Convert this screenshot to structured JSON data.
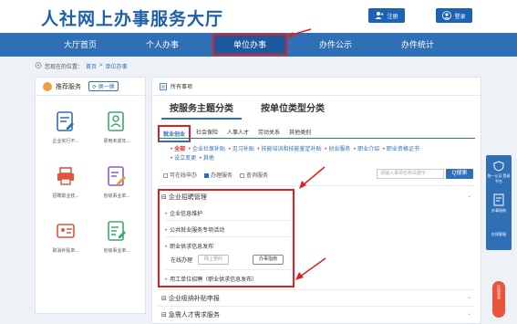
{
  "header": {
    "logo": "人社网上办事服务大厅",
    "register_label": "注册",
    "login_label": "登录"
  },
  "nav": {
    "items": [
      {
        "label": "大厅首页"
      },
      {
        "label": "个人办事"
      },
      {
        "label": "单位办事"
      },
      {
        "label": "办件公示"
      },
      {
        "label": "办件统计"
      }
    ]
  },
  "breadcrumb": {
    "prefix": "您现在的位置：",
    "home": "首页",
    "sep": ">",
    "current": "单位办事"
  },
  "left_panel": {
    "title": "推荐服务",
    "swap_label": "换一换",
    "tiles": [
      {
        "label": "企业实行不...",
        "icon": "form-edit-icon",
        "color": "#2e6fb5"
      },
      {
        "label": "录用未成年...",
        "icon": "person-doc-icon",
        "color": "#3ca86a"
      },
      {
        "label": "招聘职业技...",
        "icon": "printer-icon",
        "color": "#e0553a"
      },
      {
        "label": "省级事业单...",
        "icon": "pencil-doc-icon",
        "color": "#8a5cc8"
      },
      {
        "label": "取消补贴单...",
        "icon": "id-card-icon",
        "color": "#e0553a"
      },
      {
        "label": "省级事业单...",
        "icon": "write-doc-icon",
        "color": "#3ca86a"
      }
    ]
  },
  "main": {
    "header_label": "所有事项",
    "top_tabs": [
      {
        "label": "按服务主题分类"
      },
      {
        "label": "按单位类型分类"
      }
    ],
    "categories": [
      {
        "label": "就业创业"
      },
      {
        "label": "社会保险"
      },
      {
        "label": "人事人才"
      },
      {
        "label": "劳动关系"
      },
      {
        "label": "其他类别"
      }
    ],
    "subcategories": [
      "全部",
      "企业社保补贴",
      "见习补贴",
      "技能培训和技能鉴定补贴",
      "创业服务",
      "职业介绍",
      "职业资格证书",
      "设立变更",
      "其他"
    ],
    "filters": [
      {
        "label": "可在线申办",
        "checked": false
      },
      {
        "label": "办理服务",
        "checked": true
      },
      {
        "label": "查询服务",
        "checked": false
      }
    ],
    "search_placeholder": "请输入事项名称关键字",
    "search_button": "Q搜索",
    "section1_title": "企业招聘管理",
    "items": [
      {
        "label": "企业信息维护"
      },
      {
        "label": "公共就业服务专项活动"
      },
      {
        "label": "职业供求信息发布"
      }
    ],
    "sub_actions": {
      "online_label": "在线办理",
      "online_btn": "网上预约",
      "guide_btn": "办事指南"
    },
    "item4": "用工单位招聘（职业供求信息发布）",
    "section2_title": "企业吸纳补贴申报",
    "section3_title": "急需人才需求服务"
  },
  "right_float": {
    "top_text": "统一认证 登录平台",
    "mid_text": "办事指南",
    "bottom_text": "在线客服",
    "side_btn": "在线咨询"
  },
  "colors": {
    "primary": "#2e6fb5",
    "highlight": "#e02020"
  }
}
